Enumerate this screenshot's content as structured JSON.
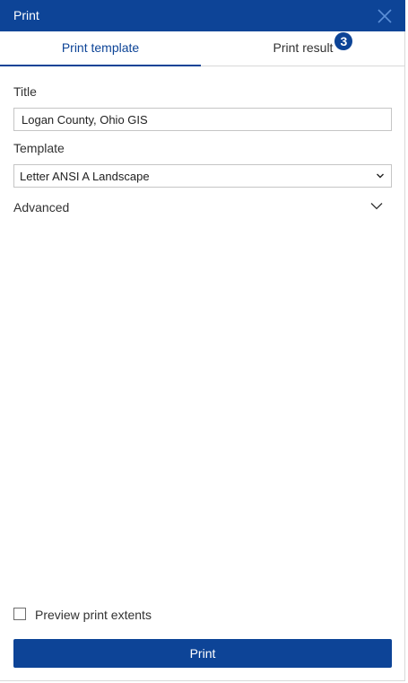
{
  "header": {
    "title": "Print",
    "close_icon": "close-icon"
  },
  "tabs": [
    {
      "label": "Print template",
      "active": true
    },
    {
      "label": "Print result",
      "active": false,
      "badge": "3"
    }
  ],
  "form": {
    "title_label": "Title",
    "title_value": "Logan County, Ohio GIS",
    "template_label": "Template",
    "template_value": "Letter ANSI A Landscape",
    "advanced_label": "Advanced"
  },
  "footer": {
    "preview_label": "Preview print extents",
    "preview_checked": false,
    "print_label": "Print"
  },
  "colors": {
    "accent": "#0d4497",
    "text": "#323232",
    "border": "#c5c5c5"
  }
}
